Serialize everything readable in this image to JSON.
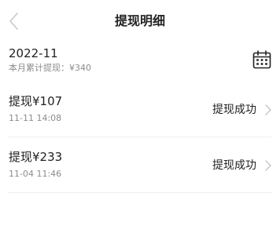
{
  "header": {
    "title": "提现明细",
    "back_icon": "chevron-left-icon"
  },
  "summary": {
    "month": "2022-11",
    "total_label": "本月累计提现：",
    "total_amount": "¥340",
    "calendar_icon": "calendar-icon"
  },
  "records": [
    {
      "amount": "提现¥107",
      "time": "11-11 14:08",
      "status": "提现成功"
    },
    {
      "amount": "提现¥233",
      "time": "11-04 11:46",
      "status": "提现成功"
    }
  ],
  "colors": {
    "primary_text": "#222222",
    "secondary_text": "#8c8c8c",
    "divider": "#eeeeee",
    "icon": "#c8c8c8"
  }
}
